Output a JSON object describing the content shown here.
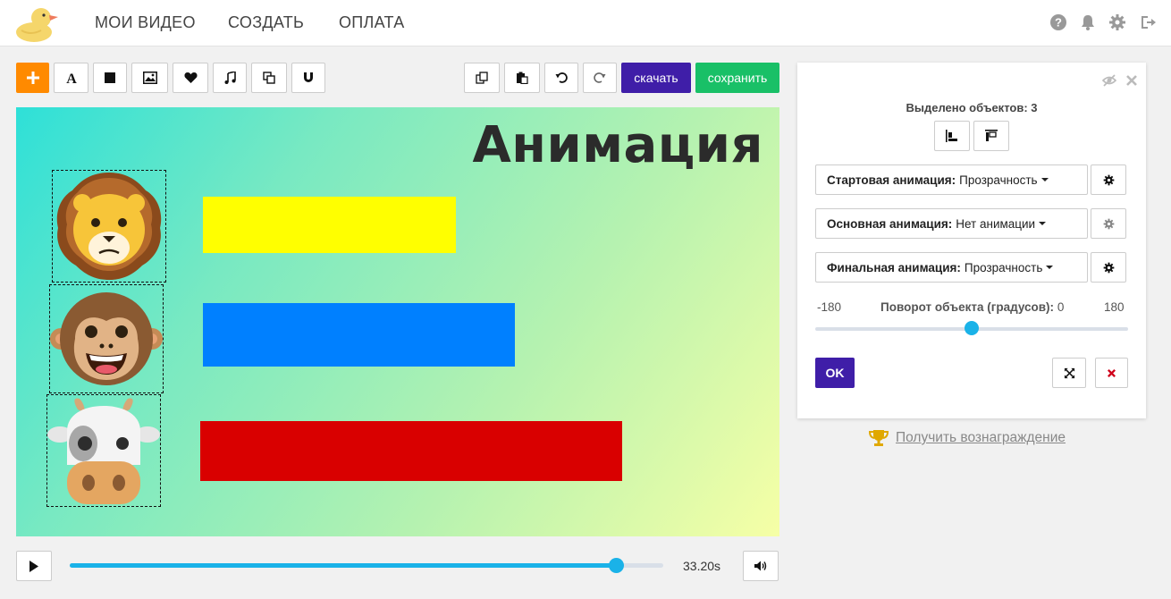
{
  "nav": {
    "items": [
      "МОИ ВИДЕО",
      "СОЗДАТЬ",
      "ОПЛАТА"
    ],
    "icons": [
      "help-icon",
      "bell-icon",
      "gear-icon",
      "logout-icon"
    ]
  },
  "toolbar": {
    "tools": [
      "add-icon",
      "text-icon",
      "shape-icon",
      "image-icon",
      "heart-icon",
      "music-icon",
      "copy-icon",
      "magnet-icon"
    ],
    "actions": [
      "copy-icon",
      "paste-icon",
      "undo-icon",
      "redo-icon"
    ],
    "download_label": "скачать",
    "save_label": "сохранить"
  },
  "canvas": {
    "title": "Анимация",
    "colors": {
      "gradient_start": "#2ee0d8",
      "gradient_end": "#f6ffa6",
      "bar_yellow": "#ffff00",
      "bar_blue": "#0080ff",
      "bar_red": "#d90000"
    },
    "emojis": [
      "lion-emoji",
      "monkey-emoji",
      "cow-emoji"
    ]
  },
  "timeline": {
    "time": "33.20s",
    "progress": 0.92
  },
  "panel": {
    "selected_label": "Выделено объектов: 3",
    "start_anim_label": "Стартовая анимация:",
    "start_anim_value": "Прозрачность",
    "main_anim_label": "Основная анимация:",
    "main_anim_value": "Нет анимации",
    "final_anim_label": "Финальная анимация:",
    "final_anim_value": "Прозрачность",
    "rotation_min": "-180",
    "rotation_max": "180",
    "rotation_label": "Поворот объекта (градусов):",
    "rotation_value": "0",
    "ok_label": "OK"
  },
  "reward": {
    "label": "Получить вознаграждение"
  },
  "accent_colors": {
    "orange": "#ff8a00",
    "purple": "#3f1ea8",
    "green": "#19c067",
    "slider": "#1ab2e8"
  }
}
